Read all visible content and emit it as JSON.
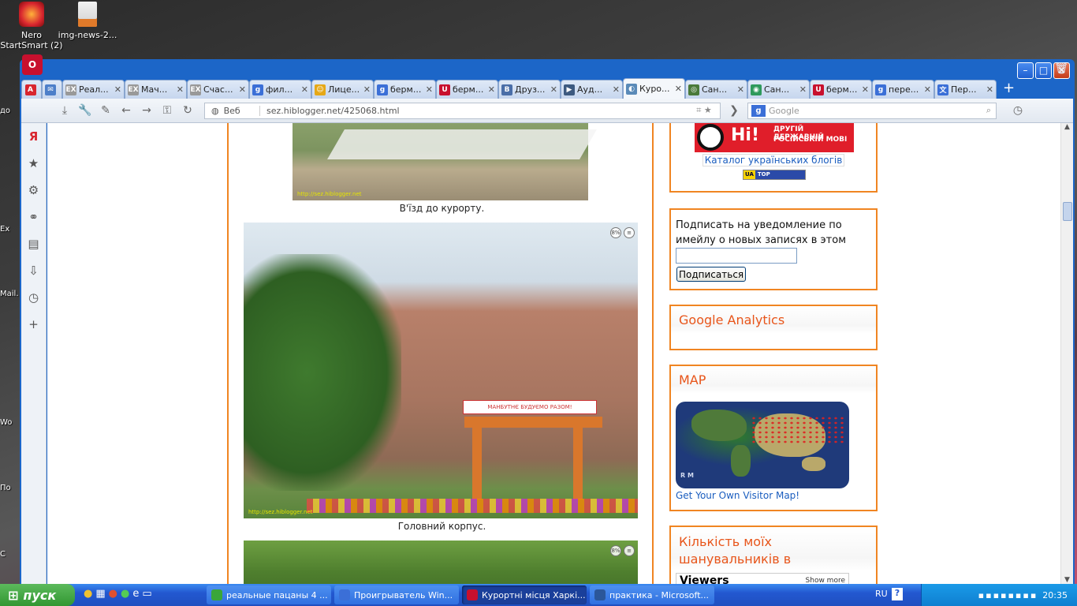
{
  "desktop": {
    "icons": [
      {
        "name": "nero-startsmart-icon",
        "label_line1": "Nero",
        "label_line2": "StartSmart (2)"
      },
      {
        "name": "img-news-file-icon",
        "label_line1": "img-news-2...",
        "label_line2": ""
      }
    ],
    "left_strip": [
      "до",
      "Ex",
      "Mail.",
      "Wo",
      "По",
      "С"
    ]
  },
  "browser": {
    "tabs": [
      {
        "fav": "A",
        "color": "#d8262f",
        "label": "",
        "first": true
      },
      {
        "fav": "✉",
        "color": "#4d7fc9",
        "label": ""
      },
      {
        "fav": "EX",
        "color": "#999999",
        "label": "Реал..."
      },
      {
        "fav": "EX",
        "color": "#999999",
        "label": "Мач..."
      },
      {
        "fav": "EX",
        "color": "#999999",
        "label": "Счас..."
      },
      {
        "fav": "g",
        "color": "#3b6fd7",
        "label": "фил..."
      },
      {
        "fav": "☺",
        "color": "#e6a817",
        "label": "Лице..."
      },
      {
        "fav": "g",
        "color": "#3b6fd7",
        "label": "берм..."
      },
      {
        "fav": "U",
        "color": "#c8102e",
        "label": "берм..."
      },
      {
        "fav": "B",
        "color": "#4a6ea8",
        "label": "Друз..."
      },
      {
        "fav": "▶",
        "color": "#3d5a80",
        "label": "Ауд..."
      },
      {
        "fav": "◐",
        "color": "#5a8ab8",
        "label": "Куро...",
        "active": true
      },
      {
        "fav": "◎",
        "color": "#4a7a3a",
        "label": "Сан..."
      },
      {
        "fav": "◉",
        "color": "#2f9a5c",
        "label": "Сан..."
      },
      {
        "fav": "U",
        "color": "#c8102e",
        "label": "берм..."
      },
      {
        "fav": "g",
        "color": "#3b6fd7",
        "label": "пере..."
      },
      {
        "fav": "文",
        "color": "#3b6fd7",
        "label": "Пер..."
      }
    ],
    "address": {
      "web_label": "Веб",
      "url": "sez.hiblogger.net/425068.html"
    },
    "search": {
      "engine": "g",
      "placeholder": "Google"
    }
  },
  "page": {
    "caption1": "В'їзд до курорту.",
    "caption2": "Головний корпус.",
    "banner_text": "МАНБУТНЄ БУДУЄМО РАЗОМ!",
    "watermark": "http://sez.hiblogger.net",
    "photo_tool_a": "8%",
    "photo_tool_b": "≡",
    "widgets": {
      "ni_banner_text1": "ДРУГІЙ ДЕРЖАВНІЙ",
      "ni_banner_text2": "РОСІЙСЬКІЙ МОВІ",
      "ni_word": "Ні!",
      "catalog_link": "Каталог українських блогів",
      "top_bloggers_ua": "UA",
      "top_bloggers": "TOP BLOGGERS",
      "subscribe_text": "Подписать на уведомление по имейлу о новых записях в этом блоге",
      "subscribe_button": "Подписаться",
      "analytics_title": "Google Analytics",
      "map_title": "MAP",
      "map_link": "Get Your Own Visitor Map!",
      "rm_logo": "R M",
      "fans_title": "Кількість моїх шанувальників в",
      "viewers": "Viewers",
      "show_more": "Show more"
    }
  },
  "taskbar": {
    "start_label": "пуск",
    "tasks": [
      {
        "label": "реальные пацаны 4 ...",
        "color": "#3aa63a"
      },
      {
        "label": "Проигрыватель Win...",
        "color": "#3b6fd7"
      },
      {
        "label": "Курортні місця Харкі...",
        "color": "#c8102e",
        "active": true
      },
      {
        "label": "практика - Microsoft...",
        "color": "#2b579a"
      }
    ],
    "lang": "RU",
    "clock": "20:35"
  }
}
